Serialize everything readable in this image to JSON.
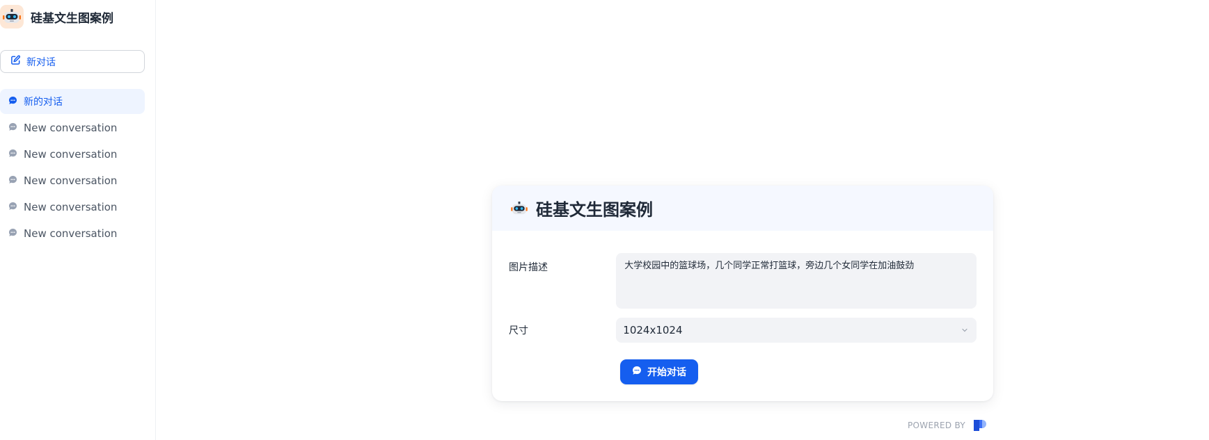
{
  "app": {
    "name": "硅基文生图案例",
    "icon": "robot-icon"
  },
  "sidebar": {
    "new_chat_label": "新对话",
    "conversations": [
      {
        "label": "新的对话",
        "active": true
      },
      {
        "label": "New conversation",
        "active": false
      },
      {
        "label": "New conversation",
        "active": false
      },
      {
        "label": "New conversation",
        "active": false
      },
      {
        "label": "New conversation",
        "active": false
      },
      {
        "label": "New conversation",
        "active": false
      }
    ]
  },
  "card": {
    "title": "硅基文生图案例",
    "fields": {
      "description": {
        "label": "图片描述",
        "value": "大学校园中的篮球场，几个同学正常打篮球，旁边几个女同学在加油鼓劲"
      },
      "size": {
        "label": "尺寸",
        "value": "1024x1024"
      }
    },
    "start_button_label": "开始对话"
  },
  "footer": {
    "powered_by": "POWERED BY"
  },
  "colors": {
    "accent": "#155eef",
    "active_bg": "#eef4ff",
    "input_bg": "#f2f3f6",
    "header_bg": "#f5f8ff"
  }
}
